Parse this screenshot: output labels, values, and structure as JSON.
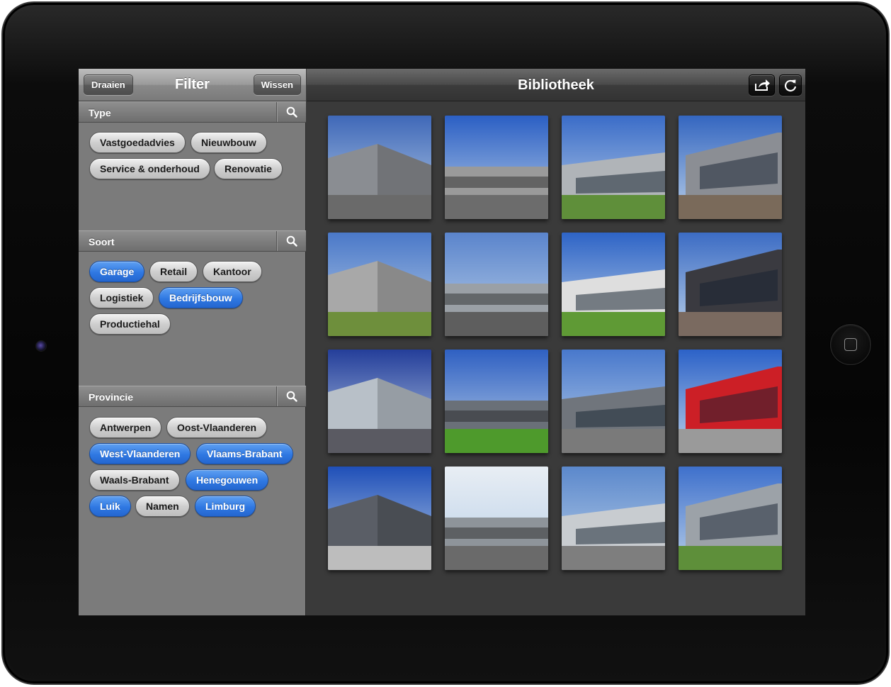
{
  "sidebar": {
    "title": "Filter",
    "rotate_label": "Draaien",
    "clear_label": "Wissen",
    "sections": [
      {
        "label": "Type",
        "tags": [
          {
            "label": "Vastgoedadvies",
            "selected": false
          },
          {
            "label": "Nieuwbouw",
            "selected": false
          },
          {
            "label": "Service & onderhoud",
            "selected": false
          },
          {
            "label": "Renovatie",
            "selected": false
          }
        ]
      },
      {
        "label": "Soort",
        "tags": [
          {
            "label": "Garage",
            "selected": true
          },
          {
            "label": "Retail",
            "selected": false
          },
          {
            "label": "Kantoor",
            "selected": false
          },
          {
            "label": "Logistiek",
            "selected": false
          },
          {
            "label": "Bedrijfsbouw",
            "selected": true
          },
          {
            "label": "Productiehal",
            "selected": false
          }
        ]
      },
      {
        "label": "Provincie",
        "tags": [
          {
            "label": "Antwerpen",
            "selected": false
          },
          {
            "label": "Oost-Vlaanderen",
            "selected": false
          },
          {
            "label": "West-Vlaanderen",
            "selected": true
          },
          {
            "label": "Vlaams-Brabant",
            "selected": true
          },
          {
            "label": "Waals-Brabant",
            "selected": false
          },
          {
            "label": "Henegouwen",
            "selected": true
          },
          {
            "label": "Luik",
            "selected": true
          },
          {
            "label": "Namen",
            "selected": false
          },
          {
            "label": "Limburg",
            "selected": true
          }
        ]
      }
    ]
  },
  "library": {
    "title": "Bibliotheek",
    "share_icon": "share-icon",
    "refresh_icon": "refresh-icon",
    "thumbnails": [
      {
        "sky": "#3f68b8",
        "building": "#8a8d92",
        "ground": "#6a6a6a"
      },
      {
        "sky": "#2b5fc4",
        "building": "#9a9a9a",
        "ground": "#6c6c6c"
      },
      {
        "sky": "#3a6cc8",
        "building": "#b0b4b8",
        "ground": "#5f8f3a"
      },
      {
        "sky": "#3466c0",
        "building": "#8b8e94",
        "ground": "#7a6a5a"
      },
      {
        "sky": "#4a78c8",
        "building": "#a8a8a8",
        "ground": "#6e8f3c"
      },
      {
        "sky": "#5a84cc",
        "building": "#9aa0a6",
        "ground": "#5e5e5e"
      },
      {
        "sky": "#2e64c6",
        "building": "#dedede",
        "ground": "#5f9a35"
      },
      {
        "sky": "#3c6cc4",
        "building": "#3a3a40",
        "ground": "#7a6a60"
      },
      {
        "sky": "#243e9a",
        "building": "#b8c0c8",
        "ground": "#5a5a62"
      },
      {
        "sky": "#2f60c2",
        "building": "#6a7078",
        "ground": "#4e9a2c"
      },
      {
        "sky": "#4878cc",
        "building": "#70757c",
        "ground": "#7a7a7a"
      },
      {
        "sky": "#2c62c8",
        "building": "#cc1f26",
        "ground": "#9a9a9a"
      },
      {
        "sky": "#1f4fb8",
        "building": "#5a5e66",
        "ground": "#bdbdbd"
      },
      {
        "sky": "#e8eef4",
        "building": "#8e949a",
        "ground": "#6a6a6a"
      },
      {
        "sky": "#5b88cc",
        "building": "#c8ccd0",
        "ground": "#7e7e7e"
      },
      {
        "sky": "#3e70cc",
        "building": "#9ca2a8",
        "ground": "#5e8f3a"
      }
    ]
  }
}
